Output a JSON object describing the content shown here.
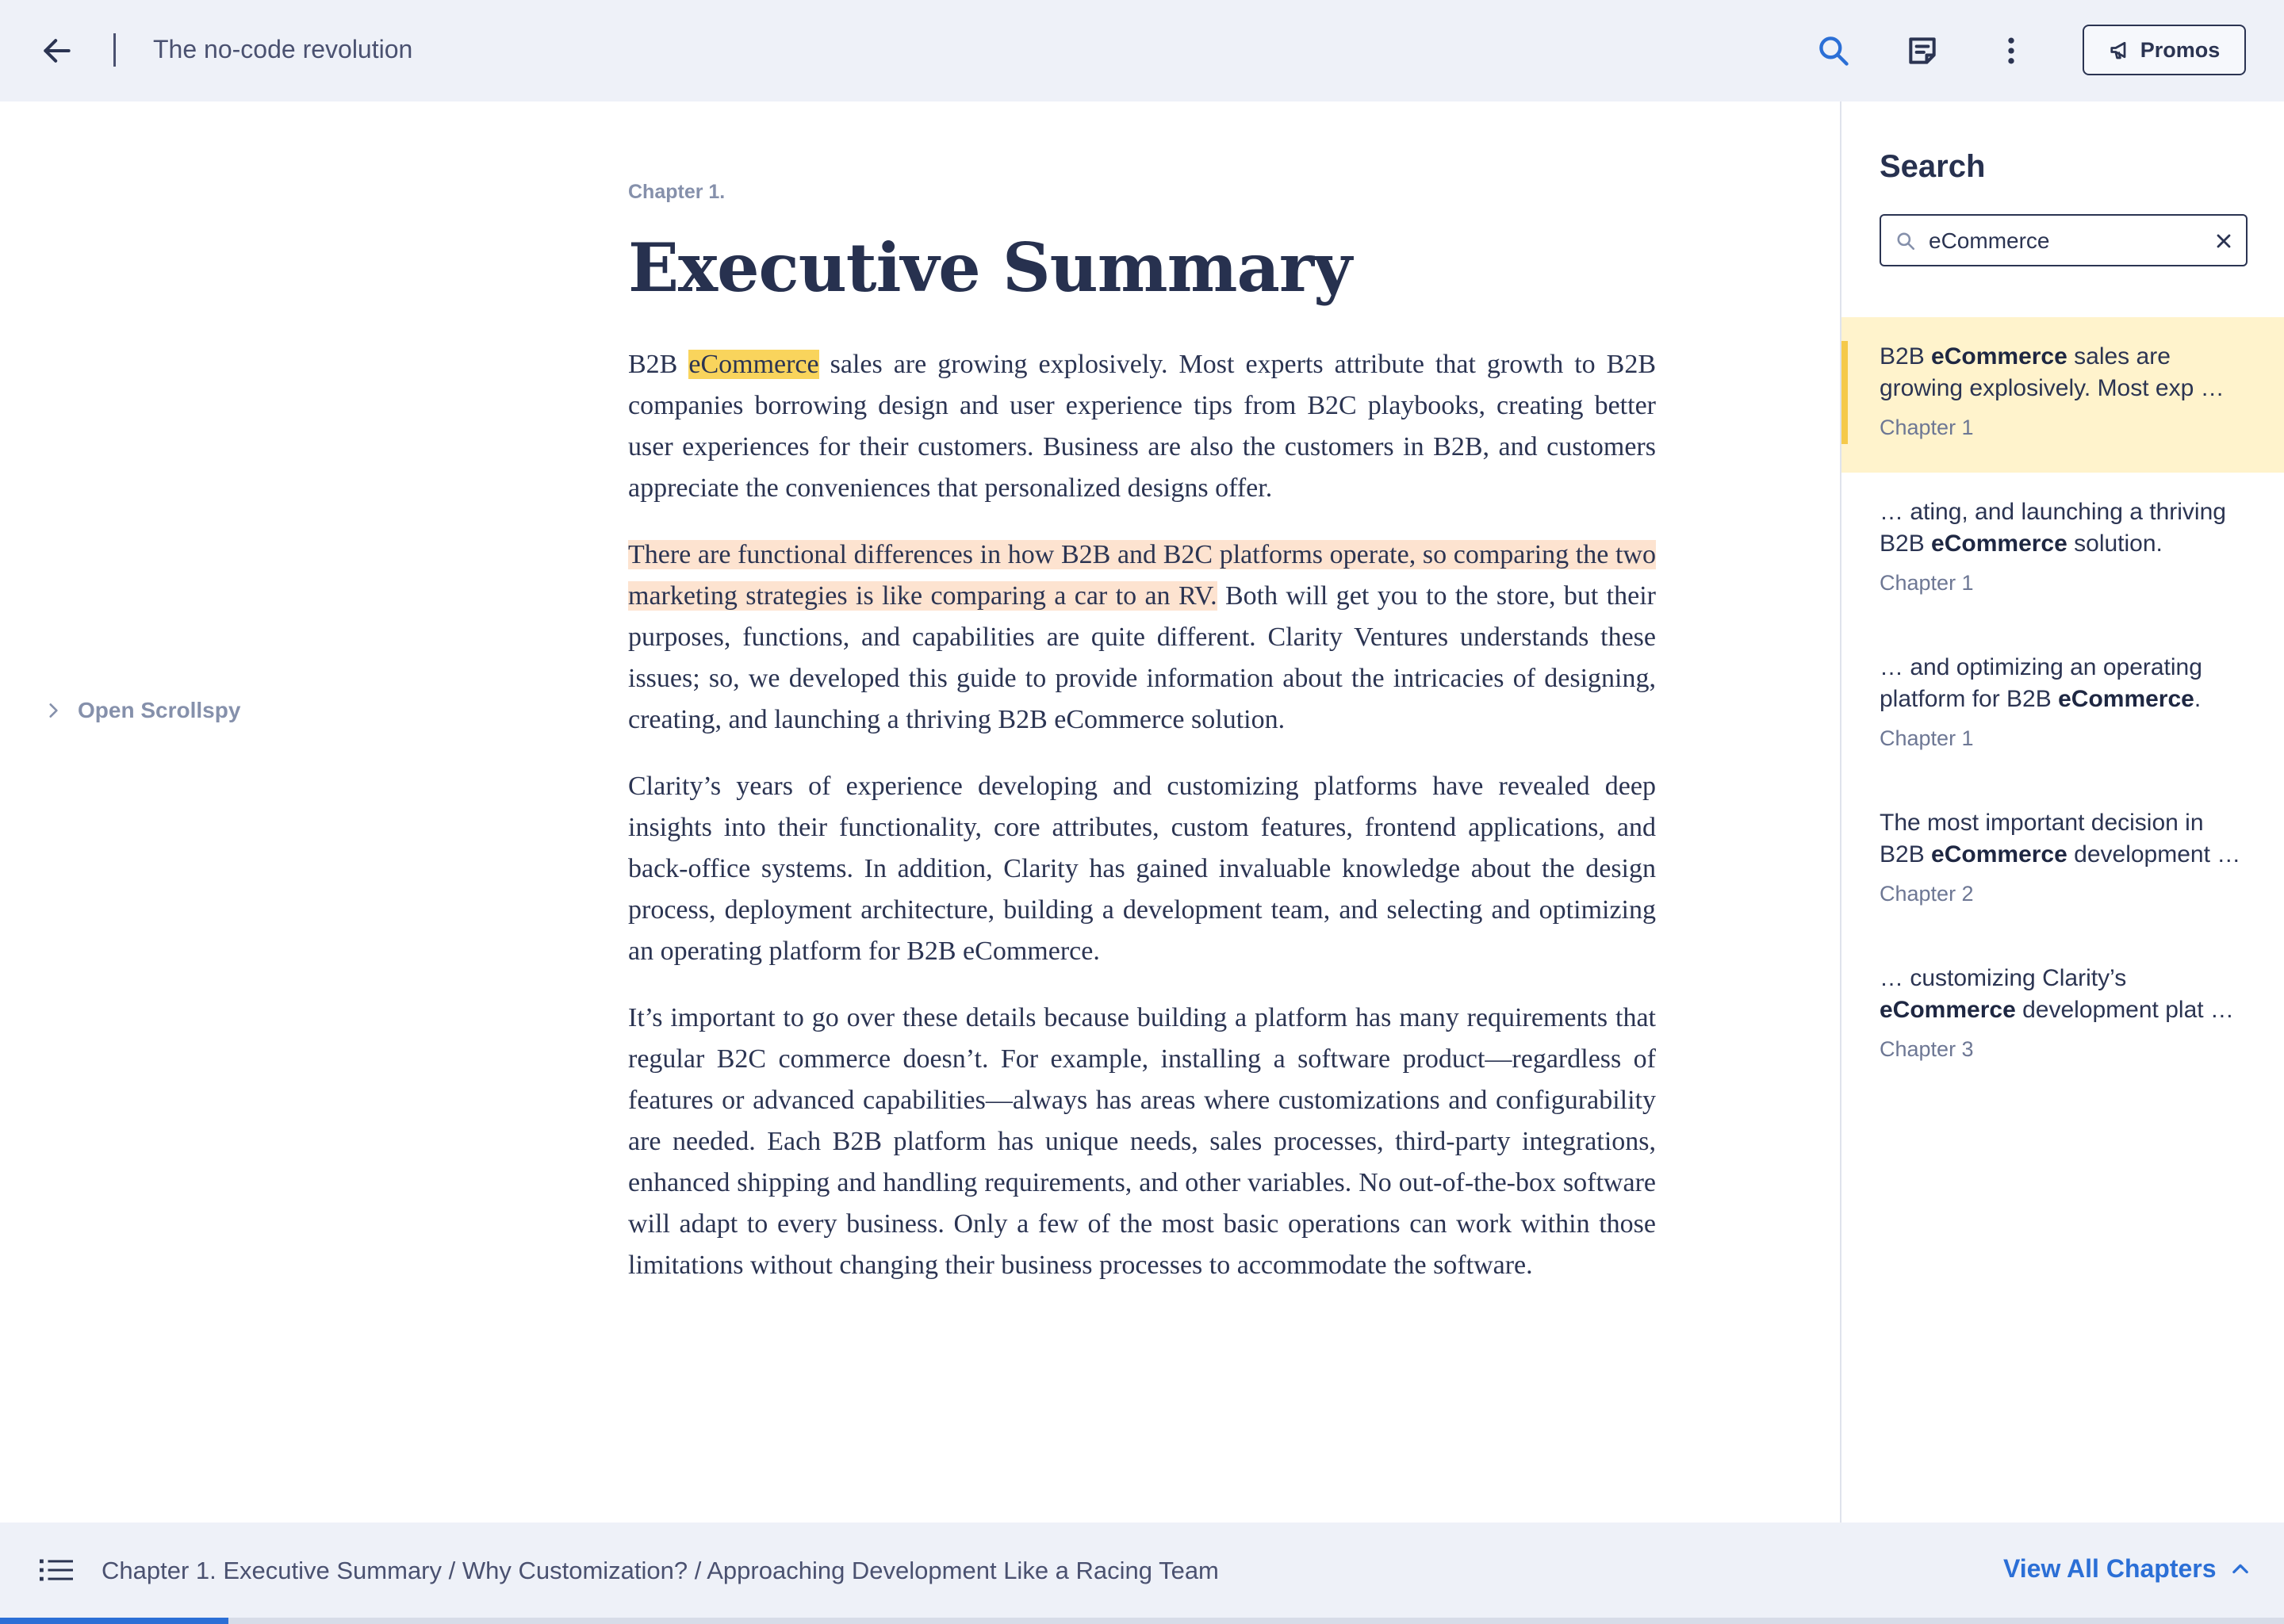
{
  "topbar": {
    "title": "The no-code revolution",
    "promos_label": "Promos"
  },
  "scrollspy": {
    "label": "Open Scrollspy"
  },
  "article": {
    "chapter_label": "Chapter 1.",
    "title": "Executive Summary",
    "p1": {
      "pre": "B2B ",
      "highlight": "eCommerce",
      "post": " sales are growing explosively. Most experts attribute that growth to B2B companies borrowing design and user experience tips from B2C playbooks, creating better user experiences for their customers. Business are also the customers in B2B, and customers appreciate the conveniences that personalized designs offer."
    },
    "p2": {
      "highlight": "There are functional differences in how B2B and B2C platforms operate, so comparing the two marketing strategies is like comparing a car to an RV.",
      "post": " Both will get you to the store, but their purposes, functions, and capabilities are quite different. Clarity Ventures understands these issues; so, we developed this guide to provide information about the intricacies of designing, creating, and launching a thriving B2B eCommerce solution."
    },
    "p3": "Clarity’s years of experience developing and customizing platforms have revealed deep insights into their functionality, core attributes, custom features, frontend applications, and back-office systems. In addition, Clarity has gained invaluable knowledge about the design process, deployment architecture, building a development team, and selecting and optimizing an operating platform for B2B eCommerce.",
    "p4": "It’s important to go over these details because building a platform has many requirements that regular B2C commerce doesn’t. For example, installing a software product—regardless of features or advanced capabilities—always has areas where customizations and configurability are needed. Each B2B platform has unique needs, sales processes, third-party integrations, enhanced shipping and handling requirements, and other variables. No out-of-the-box software will adapt to every business. Only a few of the most basic operations can work within those limitations without changing their business processes to accommodate the software."
  },
  "search": {
    "heading": "Search",
    "query": "eCommerce",
    "results": [
      {
        "pre": "B2B ",
        "match": "eCommerce",
        "post": " sales are growing explosively. Most exp …",
        "chapter": "Chapter 1",
        "active": true
      },
      {
        "pre": "… ating, and launching a thriving B2B ",
        "match": "eCommerce",
        "post": " solution.",
        "chapter": "Chapter 1",
        "active": false
      },
      {
        "pre": "… and optimizing an operating platform for B2B ",
        "match": "eCommerce",
        "post": ".",
        "chapter": "Chapter 1",
        "active": false
      },
      {
        "pre": "The most important decision in B2B ",
        "match": "eCommerce",
        "post": " development …",
        "chapter": "Chapter 2",
        "active": false
      },
      {
        "pre": "… customizing Clarity’s ",
        "match": "eCommerce",
        "post": " development plat …",
        "chapter": "Chapter 3",
        "active": false
      }
    ]
  },
  "bottombar": {
    "breadcrumb": "Chapter 1. Executive Summary / Why Customization? / Approaching Development Like a Racing Team",
    "view_all_label": "View All Chapters",
    "progress": 0.1
  },
  "colors": {
    "accent": "#2b6fd6",
    "highlight_word": "#f9d45c",
    "highlight_sentence": "#fde3d0",
    "active_result_bg": "#fff3cc",
    "bar_bg": "#eef1f8"
  },
  "icons": {
    "back": "arrow-left-icon",
    "search": "search-icon",
    "notes": "notes-icon",
    "more": "more-vertical-icon",
    "promos": "megaphone-icon",
    "scrollspy": "chevron-right-icon",
    "clear": "close-icon",
    "toc": "list-icon",
    "view_all": "chevron-up-icon"
  }
}
